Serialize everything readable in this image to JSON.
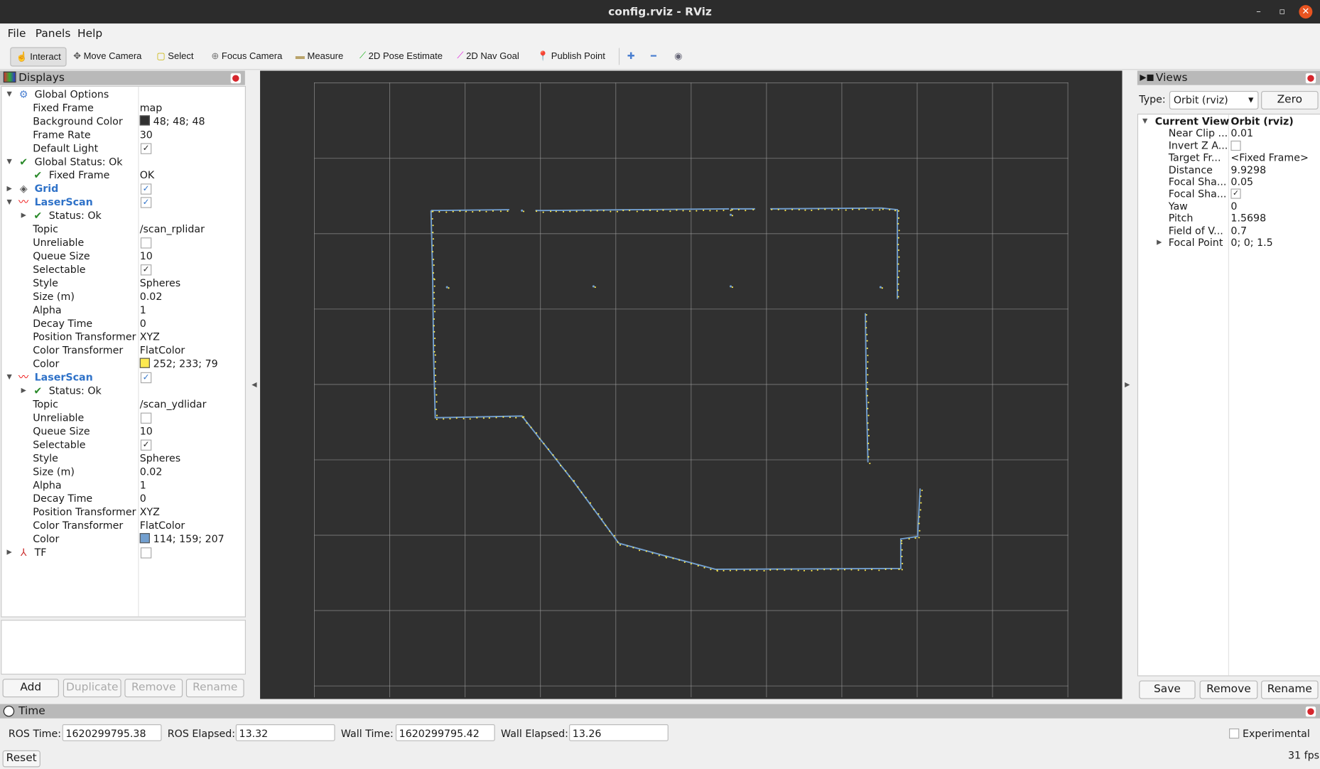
{
  "window": {
    "title": "config.rviz - RViz"
  },
  "menu": [
    "File",
    "Panels",
    "Help"
  ],
  "toolbar": [
    {
      "label": "Interact",
      "icon": "hand-pointer-icon",
      "active": true
    },
    {
      "label": "Move Camera",
      "icon": "move-camera-icon"
    },
    {
      "label": "Select",
      "icon": "select-icon"
    },
    {
      "label": "Focus Camera",
      "icon": "focus-camera-icon"
    },
    {
      "label": "Measure",
      "icon": "ruler-icon"
    },
    {
      "label": "2D Pose Estimate",
      "icon": "green-arrow-icon"
    },
    {
      "label": "2D Nav Goal",
      "icon": "magenta-arrow-icon"
    },
    {
      "label": "Publish Point",
      "icon": "map-pin-icon"
    }
  ],
  "displays": {
    "title": "Displays",
    "items": [
      {
        "name": "Global Options",
        "level": 0,
        "exp": "open",
        "icon": "gear-icon"
      },
      {
        "name": "Fixed Frame",
        "level": 1,
        "value": "map"
      },
      {
        "name": "Background Color",
        "level": 1,
        "value": "48; 48; 48",
        "swatch": "#303030"
      },
      {
        "name": "Frame Rate",
        "level": 1,
        "value": "30"
      },
      {
        "name": "Default Light",
        "level": 1,
        "check": true
      },
      {
        "name": "Global Status: Ok",
        "level": 0,
        "exp": "open",
        "icon": "checkmark-icon"
      },
      {
        "name": "Fixed Frame",
        "level": 2,
        "value": "OK",
        "icon": "checkmark-icon"
      },
      {
        "name": "Grid",
        "level": 0,
        "exp": "closed",
        "icon": "grid-icon",
        "blue": true,
        "check": true
      },
      {
        "name": "LaserScan",
        "level": 0,
        "exp": "open",
        "icon": "laserscan-icon",
        "blue": true,
        "check": true
      },
      {
        "name": "Status: Ok",
        "level": 2,
        "exp": "closed",
        "icon": "checkmark-icon"
      },
      {
        "name": "Topic",
        "level": 1,
        "value": "/scan_rplidar"
      },
      {
        "name": "Unreliable",
        "level": 1,
        "check": false
      },
      {
        "name": "Queue Size",
        "level": 1,
        "value": "10"
      },
      {
        "name": "Selectable",
        "level": 1,
        "check": true
      },
      {
        "name": "Style",
        "level": 1,
        "value": "Spheres"
      },
      {
        "name": "Size (m)",
        "level": 1,
        "value": "0.02"
      },
      {
        "name": "Alpha",
        "level": 1,
        "value": "1"
      },
      {
        "name": "Decay Time",
        "level": 1,
        "value": "0"
      },
      {
        "name": "Position Transformer",
        "level": 1,
        "value": "XYZ"
      },
      {
        "name": "Color Transformer",
        "level": 1,
        "value": "FlatColor"
      },
      {
        "name": "Color",
        "level": 1,
        "value": "252; 233; 79",
        "swatch": "#fce94f"
      },
      {
        "name": "LaserScan",
        "level": 0,
        "exp": "open",
        "icon": "laserscan-icon",
        "blue": true,
        "check": true
      },
      {
        "name": "Status: Ok",
        "level": 2,
        "exp": "closed",
        "icon": "checkmark-icon"
      },
      {
        "name": "Topic",
        "level": 1,
        "value": "/scan_ydlidar"
      },
      {
        "name": "Unreliable",
        "level": 1,
        "check": false
      },
      {
        "name": "Queue Size",
        "level": 1,
        "value": "10"
      },
      {
        "name": "Selectable",
        "level": 1,
        "check": true
      },
      {
        "name": "Style",
        "level": 1,
        "value": "Spheres"
      },
      {
        "name": "Size (m)",
        "level": 1,
        "value": "0.02"
      },
      {
        "name": "Alpha",
        "level": 1,
        "value": "1"
      },
      {
        "name": "Decay Time",
        "level": 1,
        "value": "0"
      },
      {
        "name": "Position Transformer",
        "level": 1,
        "value": "XYZ"
      },
      {
        "name": "Color Transformer",
        "level": 1,
        "value": "FlatColor"
      },
      {
        "name": "Color",
        "level": 1,
        "value": "114; 159; 207",
        "swatch": "#729fcf"
      },
      {
        "name": "TF",
        "level": 0,
        "exp": "closed",
        "icon": "tf-axes-icon",
        "check": false
      }
    ],
    "buttons": {
      "add": "Add",
      "duplicate": "Duplicate",
      "remove": "Remove",
      "rename": "Rename"
    }
  },
  "views": {
    "title": "Views",
    "type_label": "Type:",
    "type_value": "Orbit (rviz)",
    "zero": "Zero",
    "header": {
      "name": "Current View",
      "value": "Orbit (rviz)"
    },
    "props": [
      {
        "name": "Near Clip ...",
        "value": "0.01"
      },
      {
        "name": "Invert Z A...",
        "check": false
      },
      {
        "name": "Target Fr...",
        "value": "<Fixed Frame>"
      },
      {
        "name": "Distance",
        "value": "9.9298"
      },
      {
        "name": "Focal Sha...",
        "value": "0.05"
      },
      {
        "name": "Focal Sha...",
        "check": true
      },
      {
        "name": "Yaw",
        "value": "0"
      },
      {
        "name": "Pitch",
        "value": "1.5698"
      },
      {
        "name": "Field of V...",
        "value": "0.7"
      },
      {
        "name": "Focal Point",
        "value": "0; 0; 1.5",
        "exp": "closed"
      }
    ],
    "buttons": {
      "save": "Save",
      "remove": "Remove",
      "rename": "Rename"
    }
  },
  "time": {
    "title": "Time",
    "ros_time_label": "ROS Time:",
    "ros_time": "1620299795.38",
    "ros_elapsed_label": "ROS Elapsed:",
    "ros_elapsed": "13.32",
    "wall_time_label": "Wall Time:",
    "wall_time": "1620299795.42",
    "wall_elapsed_label": "Wall Elapsed:",
    "wall_elapsed": "13.26",
    "experimental": "Experimental",
    "reset": "Reset",
    "fps": "31 fps"
  },
  "colors": {
    "background": "#303030",
    "scan_rplidar": "#fce94f",
    "scan_ydlidar": "#729fcf",
    "grid": "#a0a0a0"
  }
}
